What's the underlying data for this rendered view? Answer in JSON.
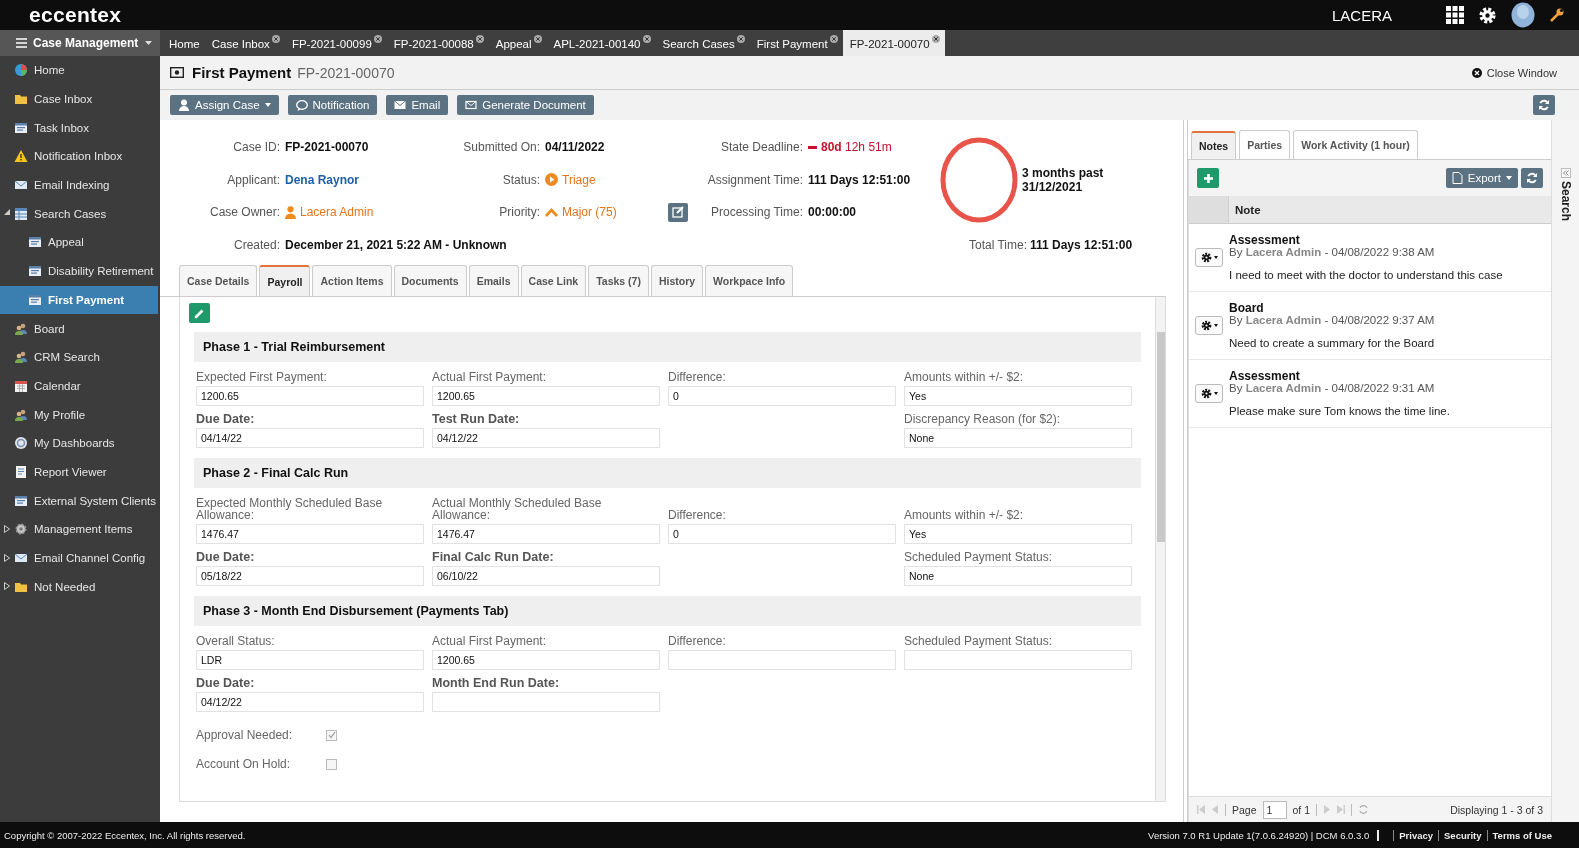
{
  "brand": "eccentex",
  "topbar": {
    "org": "LACERA"
  },
  "sidebar": {
    "title": "Case Management",
    "items": [
      {
        "label": "Home",
        "kind": "leaf",
        "selected": false
      },
      {
        "label": "Case Inbox",
        "kind": "leaf",
        "selected": false
      },
      {
        "label": "Task Inbox",
        "kind": "leaf",
        "selected": false
      },
      {
        "label": "Notification Inbox",
        "kind": "leaf",
        "selected": false
      },
      {
        "label": "Email Indexing",
        "kind": "leaf",
        "selected": false
      },
      {
        "label": "Search Cases",
        "kind": "folder",
        "expanded": true,
        "selected": false,
        "children": [
          {
            "label": "Appeal",
            "selected": false
          },
          {
            "label": "Disability Retirement",
            "selected": false
          },
          {
            "label": "First Payment",
            "selected": true
          }
        ]
      },
      {
        "label": "Board",
        "kind": "leaf",
        "selected": false
      },
      {
        "label": "CRM Search",
        "kind": "leaf",
        "selected": false
      },
      {
        "label": "Calendar",
        "kind": "leaf",
        "selected": false
      },
      {
        "label": "My Profile",
        "kind": "leaf",
        "selected": false
      },
      {
        "label": "My Dashboards",
        "kind": "leaf",
        "selected": false
      },
      {
        "label": "Report Viewer",
        "kind": "leaf",
        "selected": false
      },
      {
        "label": "External System Clients",
        "kind": "leaf",
        "selected": false
      },
      {
        "label": "Management Items",
        "kind": "folder",
        "expanded": false,
        "selected": false
      },
      {
        "label": "Email Channel Config",
        "kind": "folder",
        "expanded": false,
        "selected": false
      },
      {
        "label": "Not Needed",
        "kind": "folder",
        "expanded": false,
        "selected": false
      }
    ]
  },
  "tabs": [
    {
      "label": "Home",
      "closable": false,
      "selected": false
    },
    {
      "label": "Case Inbox",
      "closable": true,
      "selected": false
    },
    {
      "label": "FP-2021-00099",
      "closable": true,
      "selected": false
    },
    {
      "label": "FP-2021-00088",
      "closable": true,
      "selected": false
    },
    {
      "label": "Appeal",
      "closable": true,
      "selected": false
    },
    {
      "label": "APL-2021-00140",
      "closable": true,
      "selected": false
    },
    {
      "label": "Search Cases",
      "closable": true,
      "selected": false
    },
    {
      "label": "First Payment",
      "closable": true,
      "selected": false
    },
    {
      "label": "FP-2021-00070",
      "closable": true,
      "selected": true
    }
  ],
  "case": {
    "title": "First Payment",
    "id": "FP-2021-00070",
    "close_label": "Close Window"
  },
  "toolbar": [
    {
      "label": "Assign Case",
      "kind": "dropdown"
    },
    {
      "label": "Notification",
      "kind": "plain"
    },
    {
      "label": "Email",
      "kind": "plain"
    },
    {
      "label": "Generate Document",
      "kind": "plain"
    }
  ],
  "summary": {
    "fields": [
      {
        "label": "Case ID:",
        "value": "FP-2021-00070",
        "kind": "bold"
      },
      {
        "label": "Submitted On:",
        "value": "04/11/2022",
        "kind": "bold"
      },
      {
        "label": "State Deadline:",
        "value": "**80d** 12h 51m",
        "kind": "deadline"
      },
      {
        "label": "Applicant:",
        "value": "Dena Raynor",
        "kind": "link"
      },
      {
        "label": "Status:",
        "value": "Triage",
        "kind": "status"
      },
      {
        "label": "Assignment Time:",
        "value": "111 Days 12:51:00",
        "kind": "bold"
      },
      {
        "label": "Case Owner:",
        "value": "Lacera Admin",
        "kind": "owner"
      },
      {
        "label": "Priority:",
        "value": "Major (75)",
        "kind": "priority"
      },
      {
        "label": "Processing Time:",
        "value": "00:00:00",
        "kind": "bold"
      },
      {
        "label": "Created:",
        "value": "December 21, 2021 5:22 AM - Unknown",
        "kind": "bold"
      }
    ],
    "overdue": [
      "3 months past",
      "31/12/2021"
    ],
    "total": {
      "label": "Total Time:",
      "value": "111 Days 12:51:00"
    }
  },
  "case_tabs": [
    {
      "label": "Case Details",
      "selected": false
    },
    {
      "label": "Payroll",
      "selected": true
    },
    {
      "label": "Action Items",
      "selected": false
    },
    {
      "label": "Documents",
      "selected": false
    },
    {
      "label": "Emails",
      "selected": false
    },
    {
      "label": "Case Link",
      "selected": false
    },
    {
      "label": "Tasks (7)",
      "selected": false
    },
    {
      "label": "History",
      "selected": false
    },
    {
      "label": "Workpace Info",
      "selected": false
    }
  ],
  "payroll": {
    "sections": [
      {
        "title": "Phase 1 - Trial Reimbursement",
        "rows": [
          [
            {
              "label": "Expected First Payment:",
              "value": "1200.65",
              "kind": "input"
            },
            {
              "label": "Actual First Payment:",
              "value": "1200.65",
              "kind": "input"
            },
            {
              "label": "Difference:",
              "value": "0",
              "kind": "input"
            },
            {
              "label": "Amounts within +/- $2:",
              "value": "Yes",
              "kind": "input"
            }
          ],
          [
            {
              "label": "Due Date:",
              "value": "04/14/22",
              "kind": "date"
            },
            {
              "label": "Test Run Date:",
              "value": "04/12/22",
              "kind": "date"
            },
            {
              "kind": "blank"
            },
            {
              "label": "Discrepancy Reason (for $2):",
              "value": "None",
              "kind": "input"
            }
          ]
        ]
      },
      {
        "title": "Phase 2 - Final Calc Run",
        "rows": [
          [
            {
              "label": "Expected Monthly Scheduled Base Allowance:",
              "value": "1476.47",
              "kind": "input"
            },
            {
              "label": "Actual Monthly Scheduled Base Allowance:",
              "value": "1476.47",
              "kind": "input"
            },
            {
              "label": "Difference:",
              "value": "0",
              "kind": "input"
            },
            {
              "label": "Amounts within +/- $2:",
              "value": "Yes",
              "kind": "input"
            }
          ],
          [
            {
              "label": "Due Date:",
              "value": "05/18/22",
              "kind": "date"
            },
            {
              "label": "Final Calc Run Date:",
              "value": "06/10/22",
              "kind": "date"
            },
            {
              "kind": "blank"
            },
            {
              "label": "Scheduled Payment Status:",
              "value": "None",
              "kind": "input"
            }
          ]
        ]
      },
      {
        "title": "Phase 3 - Month End Disbursement (Payments Tab)",
        "rows": [
          [
            {
              "label": "Overall Status:",
              "value": "LDR",
              "kind": "input"
            },
            {
              "label": "Actual First Payment:",
              "value": "1200.65",
              "kind": "input"
            },
            {
              "label": "Difference:",
              "kind": "input"
            },
            {
              "label": "Scheduled Payment Status:",
              "kind": "input"
            }
          ],
          [
            {
              "label": "Due Date:",
              "value": "04/12/22",
              "kind": "date"
            },
            {
              "label": "Month End Run Date:",
              "kind": "date"
            }
          ]
        ]
      }
    ],
    "checks": [
      {
        "label": "Approval Needed:",
        "checked": true
      },
      {
        "label": "Account On Hold:",
        "checked": false
      }
    ]
  },
  "notes": {
    "tabs": [
      {
        "label": "Notes",
        "selected": true
      },
      {
        "label": "Parties",
        "selected": false
      },
      {
        "label": "Work Activity (1 hour)",
        "selected": false
      }
    ],
    "export_label": "Export",
    "column": "Note",
    "items": [
      {
        "title": "Assessment",
        "byline": "By **Lacera Admin** - 04/08/2022 9:38 AM",
        "text": "I need to meet with the doctor to understand this case"
      },
      {
        "title": "Board",
        "byline": "By **Lacera Admin** - 04/08/2022 9:37 AM",
        "text": "Need to create a summary for the Board"
      },
      {
        "title": "Assessment",
        "byline": "By **Lacera Admin** - 04/08/2022 9:31 AM",
        "text": "Please make sure Tom knows the time line."
      }
    ],
    "pager": {
      "page_label": "Page",
      "page": "1",
      "of": "of 1",
      "display": "Displaying 1 - 3 of 3"
    },
    "side_label": "Search"
  },
  "footer": {
    "copyright": "Copyright © 2007-2022 Eccentex, Inc. All rights reserved.",
    "version": "Version  7.0 R1 Update 1(7.0.6.24920) | DCM 6.0.3.0",
    "links": [
      "Privacy",
      "Security",
      "Terms of Use"
    ]
  }
}
